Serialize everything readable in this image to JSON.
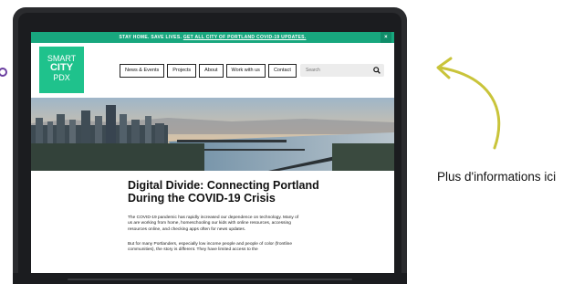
{
  "banner": {
    "lead": "STAY HOME. SAVE LIVES.",
    "link": "GET ALL CITY OF PORTLAND COVID-19 UPDATES.",
    "close": "×"
  },
  "logo": {
    "line1": "SMART",
    "line2": "CITY",
    "line3": "PDX"
  },
  "nav": {
    "items": [
      {
        "label": "News & Events"
      },
      {
        "label": "Projects"
      },
      {
        "label": "About"
      },
      {
        "label": "Work with us"
      },
      {
        "label": "Contact"
      }
    ]
  },
  "search": {
    "placeholder": "Search",
    "icon": "search-icon"
  },
  "article": {
    "title": "Digital Divide: Connecting Portland During the COVID-19 Crisis",
    "paragraph1": "The COVID-19 pandemic has rapidly increased our dependence on technology. Many of us are working from home, homeschooling our kids with online resources, accessing resources online, and checking apps often for news updates.",
    "paragraph2": "But for many Portlanders, especially low income people and people of color (frontline communities), the story is different. They have limited access to the"
  },
  "callout": {
    "text": "Plus d'informations ici"
  },
  "colors": {
    "accent": "#18a77e",
    "logo": "#1fc28c",
    "arrow": "#c9c43a"
  }
}
